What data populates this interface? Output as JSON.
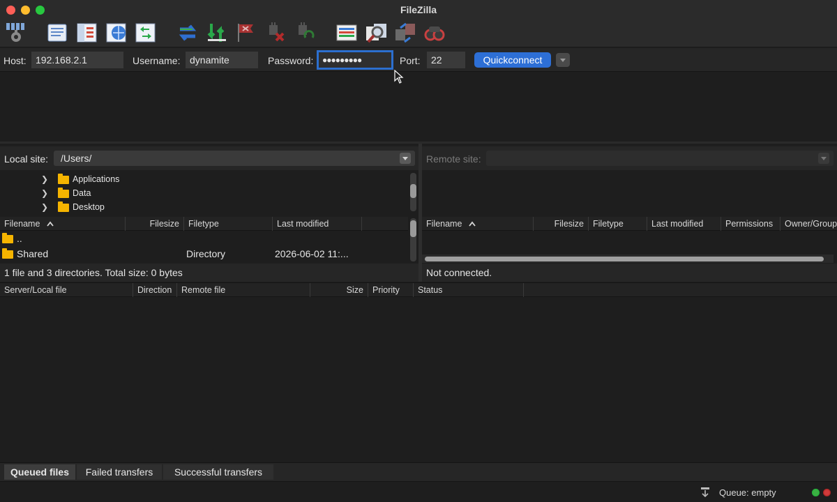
{
  "window": {
    "title": "FileZilla"
  },
  "toolbar": {
    "icons": [
      "site-manager-icon",
      "message-log-icon",
      "directory-tree-icon",
      "remote-tree-icon",
      "file-list-icon",
      "refresh-icon",
      "process-queue-icon",
      "cancel-icon",
      "disconnect-icon",
      "reconnect-icon",
      "filter-icon",
      "compare-icon",
      "sync-browse-icon",
      "search-icon"
    ]
  },
  "quickconnect": {
    "host_label": "Host:",
    "host_value": "192.168.2.1",
    "username_label": "Username:",
    "username_value": "dynamite",
    "password_label": "Password:",
    "password_value": "●●●●●●●●●",
    "port_label": "Port:",
    "port_value": "22",
    "button_label": "Quickconnect"
  },
  "local": {
    "site_label": "Local site:",
    "path": "/Users/",
    "tree": [
      {
        "label": "Applications"
      },
      {
        "label": "Data"
      },
      {
        "label": "Desktop"
      }
    ],
    "columns": [
      "Filename",
      "Filesize",
      "Filetype",
      "Last modified"
    ],
    "rows": [
      {
        "name": "..",
        "size": "",
        "type": "",
        "modified": ""
      },
      {
        "name": "Shared",
        "size": "",
        "type": "Directory",
        "modified": "2026-06-02 11:..."
      }
    ],
    "status": "1 file and 3 directories. Total size: 0 bytes"
  },
  "remote": {
    "site_label": "Remote site:",
    "path": "",
    "columns": [
      "Filename",
      "Filesize",
      "Filetype",
      "Last modified",
      "Permissions",
      "Owner/Group"
    ],
    "status": "Not connected."
  },
  "queue": {
    "columns": [
      "Server/Local file",
      "Direction",
      "Remote file",
      "Size",
      "Priority",
      "Status"
    ],
    "tabs": [
      "Queued files",
      "Failed transfers",
      "Successful transfers"
    ],
    "status": "Queue: empty"
  },
  "colors": {
    "accent": "#2d6fd6",
    "folder": "#f5b400",
    "led_green": "#3cb043",
    "led_red": "#d23b3b"
  }
}
